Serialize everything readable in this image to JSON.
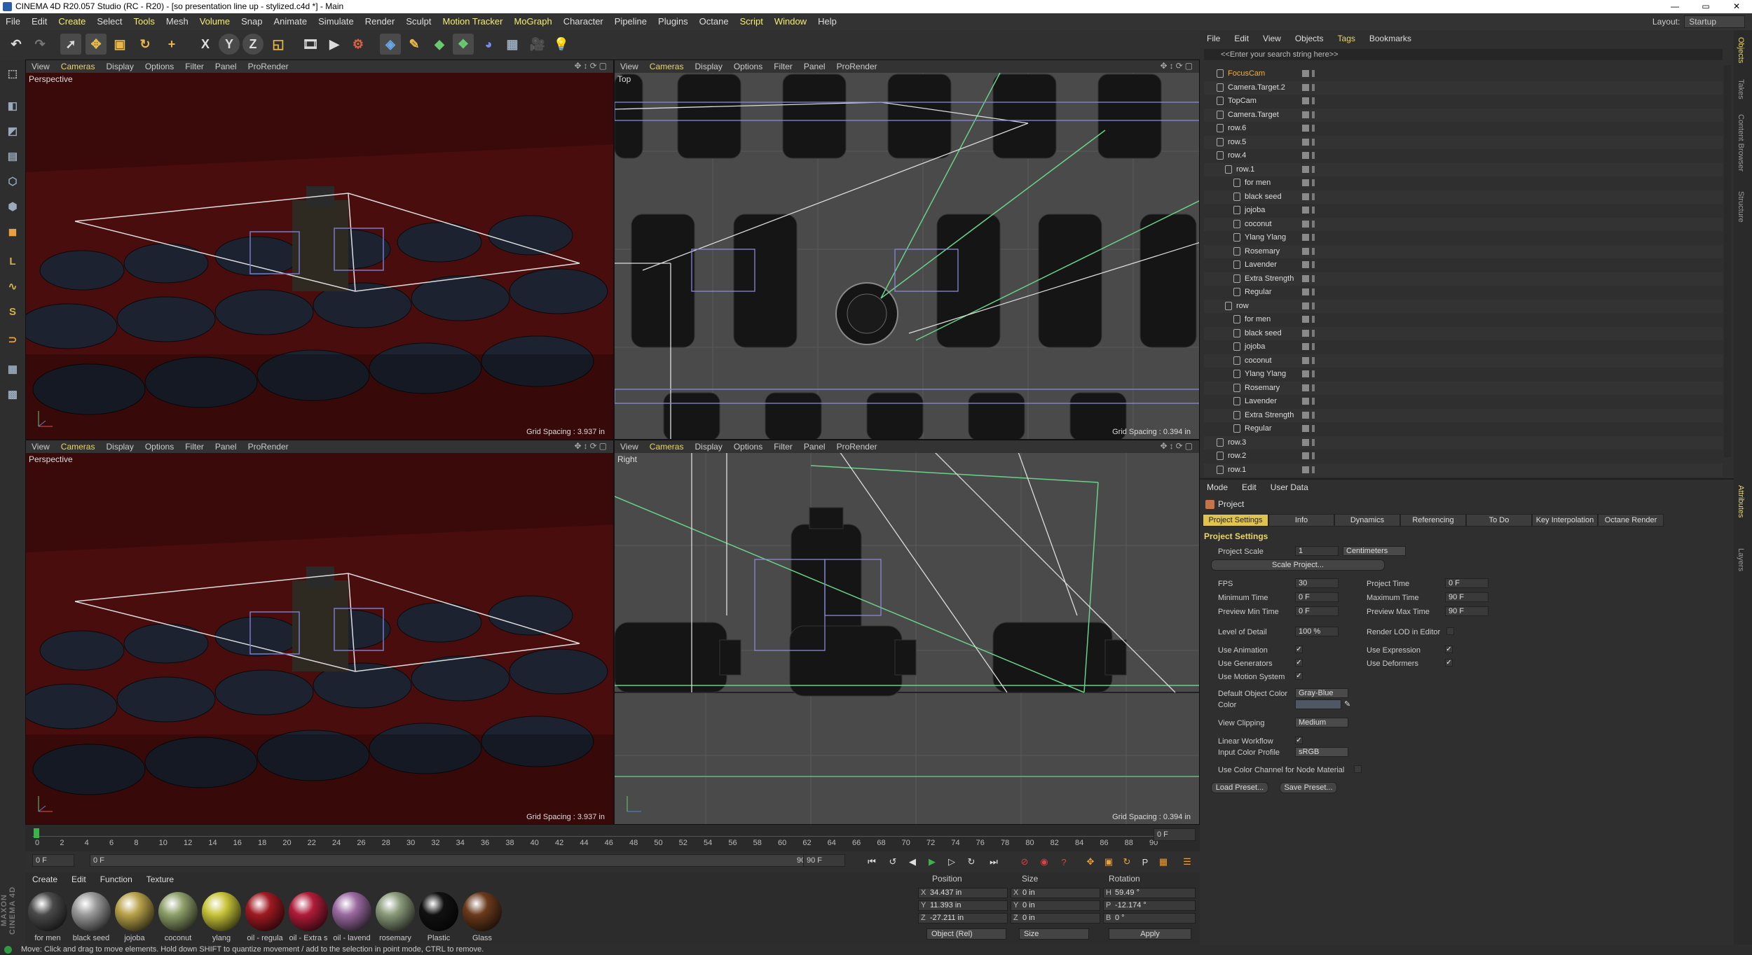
{
  "window": {
    "title": "CINEMA 4D R20.057 Studio (RC - R20) - [so presentation line up - stylized.c4d *] - Main",
    "controls": [
      "—",
      "▭",
      "✕"
    ]
  },
  "menubar": {
    "items": [
      "File",
      "Edit",
      "Create",
      "Select",
      "Tools",
      "Mesh",
      "Volume",
      "Snap",
      "Animate",
      "Simulate",
      "Render",
      "Sculpt",
      "Motion Tracker",
      "MoGraph",
      "Character",
      "Pipeline",
      "Plugins",
      "Octane",
      "Script",
      "Window",
      "Help"
    ],
    "layout_label": "Layout:",
    "layout_value": "Startup"
  },
  "toolbar": {
    "icons": [
      "undo-icon",
      "redo-icon",
      "live-select-icon",
      "move-icon",
      "scale-icon",
      "rotate-icon",
      "add-icon",
      "x-axis-icon",
      "y-axis-icon",
      "z-axis-icon",
      "coord-system-icon",
      "render-region-icon",
      "render-view-icon",
      "render-settings-icon",
      "cube-icon",
      "pen-icon",
      "subdivision-icon",
      "array-icon",
      "deformer-icon",
      "floor-icon",
      "camera-icon",
      "light-icon"
    ],
    "axes": {
      "x": "X",
      "y": "Y",
      "z": "Z"
    }
  },
  "viewports": {
    "menu": [
      "View",
      "Cameras",
      "Display",
      "Options",
      "Filter",
      "Panel",
      "ProRender"
    ],
    "top_left": {
      "label": "Perspective",
      "grid": "Grid Spacing : 3.937 in"
    },
    "top_right": {
      "label": "Top",
      "grid": "Grid Spacing : 0.394 in"
    },
    "bottom_left": {
      "label": "Perspective",
      "grid": "Grid Spacing : 3.937 in"
    },
    "bottom_right": {
      "label": "Right",
      "grid": "Grid Spacing : 0.394 in"
    }
  },
  "timeline": {
    "ticks": [
      "0",
      "2",
      "4",
      "6",
      "8",
      "10",
      "12",
      "14",
      "16",
      "18",
      "20",
      "22",
      "24",
      "26",
      "28",
      "30",
      "32",
      "34",
      "36",
      "38",
      "40",
      "42",
      "44",
      "46",
      "48",
      "50",
      "52",
      "54",
      "56",
      "58",
      "60",
      "62",
      "64",
      "66",
      "68",
      "70",
      "72",
      "74",
      "76",
      "78",
      "80",
      "82",
      "84",
      "86",
      "88",
      "90"
    ],
    "current_frame": "0 F",
    "start": "0 F",
    "start2": "0 F",
    "end_inner": "90 F",
    "end": "90 F"
  },
  "materials": {
    "menu": [
      "Create",
      "Edit",
      "Function",
      "Texture"
    ],
    "items": [
      {
        "name": "for men",
        "color": "#4a4a4a"
      },
      {
        "name": "black seed",
        "color": "#9a9a9a"
      },
      {
        "name": "jojoba",
        "color": "#b8a24a"
      },
      {
        "name": "coconut",
        "color": "#8fa06a"
      },
      {
        "name": "ylang",
        "color": "#c8c43a"
      },
      {
        "name": "oil - regula",
        "color": "#a01a22"
      },
      {
        "name": "oil - Extra s",
        "color": "#b01c3a"
      },
      {
        "name": "oil - lavend",
        "color": "#9a6aa0"
      },
      {
        "name": "rosemary",
        "color": "#8a9a7a"
      },
      {
        "name": "Plastic",
        "color": "#111111"
      },
      {
        "name": "Glass",
        "color": "#6a3a1c"
      }
    ]
  },
  "coordinates": {
    "headers": [
      "Position",
      "Size",
      "Rotation"
    ],
    "position": [
      {
        "axis": "X",
        "value": "34.437 in"
      },
      {
        "axis": "Y",
        "value": "11.393 in"
      },
      {
        "axis": "Z",
        "value": "-27.211 in"
      }
    ],
    "size": [
      {
        "axis": "X",
        "value": "0 in"
      },
      {
        "axis": "Y",
        "value": "0 in"
      },
      {
        "axis": "Z",
        "value": "0 in"
      }
    ],
    "rotation": [
      {
        "axis": "H",
        "value": "59.49 °"
      },
      {
        "axis": "P",
        "value": "-12.174 °"
      },
      {
        "axis": "B",
        "value": "0 °"
      }
    ],
    "mode": "Object (Rel)",
    "size_mode": "Size",
    "apply": "Apply"
  },
  "status": "Move: Click and drag to move elements. Hold down SHIFT to quantize movement / add to the selection in point mode, CTRL to remove.",
  "object_manager": {
    "menu": [
      "File",
      "Edit",
      "View",
      "Objects",
      "Tags",
      "Bookmarks"
    ],
    "search_placeholder": "<<Enter your search string here>>",
    "rows": [
      {
        "name": "FocusCam",
        "indent": 0,
        "highlight": true
      },
      {
        "name": "Camera.Target.2",
        "indent": 0
      },
      {
        "name": "TopCam",
        "indent": 0
      },
      {
        "name": "Camera.Target",
        "indent": 0
      },
      {
        "name": "row.6",
        "indent": 0
      },
      {
        "name": "row.5",
        "indent": 0
      },
      {
        "name": "row.4",
        "indent": 0
      },
      {
        "name": "row.1",
        "indent": 1
      },
      {
        "name": "for men",
        "indent": 2
      },
      {
        "name": "black seed",
        "indent": 2
      },
      {
        "name": "jojoba",
        "indent": 2
      },
      {
        "name": "coconut",
        "indent": 2
      },
      {
        "name": "Ylang Ylang",
        "indent": 2
      },
      {
        "name": "Rosemary",
        "indent": 2
      },
      {
        "name": "Lavender",
        "indent": 2
      },
      {
        "name": "Extra Strength",
        "indent": 2
      },
      {
        "name": "Regular",
        "indent": 2
      },
      {
        "name": "row",
        "indent": 1
      },
      {
        "name": "for men",
        "indent": 2
      },
      {
        "name": "black seed",
        "indent": 2
      },
      {
        "name": "jojoba",
        "indent": 2
      },
      {
        "name": "coconut",
        "indent": 2
      },
      {
        "name": "Ylang Ylang",
        "indent": 2
      },
      {
        "name": "Rosemary",
        "indent": 2
      },
      {
        "name": "Lavender",
        "indent": 2
      },
      {
        "name": "Extra Strength",
        "indent": 2
      },
      {
        "name": "Regular",
        "indent": 2
      },
      {
        "name": "row.3",
        "indent": 0
      },
      {
        "name": "row.2",
        "indent": 0
      },
      {
        "name": "row.1",
        "indent": 0
      }
    ]
  },
  "attributes": {
    "menu": [
      "Mode",
      "Edit",
      "User Data"
    ],
    "object": "Project",
    "tabs": [
      "Project Settings",
      "Info",
      "Dynamics",
      "Referencing",
      "To Do",
      "Key Interpolation",
      "Octane Render"
    ],
    "section": "Project Settings",
    "project_scale_label": "Project Scale",
    "project_scale": "1",
    "project_scale_unit": "Centimeters",
    "scale_project_btn": "Scale Project...",
    "fps_label": "FPS",
    "fps": "30",
    "project_time_label": "Project Time",
    "project_time": "0 F",
    "min_time_label": "Minimum Time",
    "min_time": "0 F",
    "max_time_label": "Maximum Time",
    "max_time": "90 F",
    "prev_min_label": "Preview Min Time",
    "prev_min": "0 F",
    "prev_max_label": "Preview Max Time",
    "prev_max": "90 F",
    "lod_label": "Level of Detail",
    "lod": "100 %",
    "render_lod_label": "Render LOD in Editor",
    "use_animation": "Use Animation",
    "use_expression": "Use Expression",
    "use_generators": "Use Generators",
    "use_deformers": "Use Deformers",
    "use_motion": "Use Motion System",
    "default_color_label": "Default Object Color",
    "default_color": "Gray-Blue",
    "color_label": "Color",
    "view_clipping_label": "View Clipping",
    "view_clipping": "Medium",
    "linear_workflow": "Linear Workflow",
    "input_profile_label": "Input Color Profile",
    "input_profile": "sRGB",
    "node_material": "Use Color Channel for Node Material",
    "load_preset": "Load Preset...",
    "save_preset": "Save Preset..."
  },
  "right_strip": [
    "Objects",
    "Takes",
    "Content Browser",
    "Structure",
    "Attributes",
    "Layers"
  ]
}
